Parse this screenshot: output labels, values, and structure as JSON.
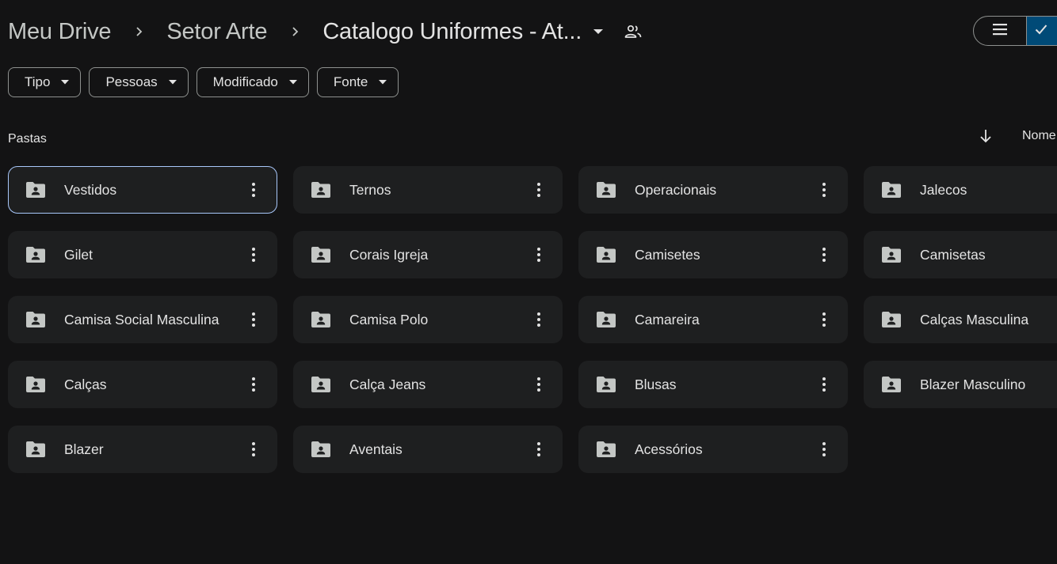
{
  "breadcrumb": {
    "items": [
      "Meu Drive",
      "Setor Arte"
    ],
    "current": "Catalogo Uniformes - At..."
  },
  "filters": [
    "Tipo",
    "Pessoas",
    "Modificado",
    "Fonte"
  ],
  "section": {
    "title": "Pastas",
    "sort_label": "Nome"
  },
  "folders": [
    "Vestidos",
    "Ternos",
    "Operacionais",
    "Jalecos",
    "Gilet",
    "Corais Igreja",
    "Camisetes",
    "Camisetas",
    "Camisa Social Masculina",
    "Camisa Polo",
    "Camareira",
    "Calças Masculina",
    "Calças",
    "Calça Jeans",
    "Blusas",
    "Blazer Masculino",
    "Blazer",
    "Aventais",
    "Acessórios"
  ],
  "selected_folder": "Vestidos",
  "icons": {
    "breadcrumb_separator": "chevron-right-icon",
    "title_dropdown": "caret-down-icon",
    "shared": "people-icon",
    "view_list": "list-view-icon",
    "view_grid_selected": "check-icon",
    "folder": "shared-folder-icon",
    "more": "more-vert-icon",
    "sort": "arrow-down-icon"
  },
  "colors": {
    "background": "#131314",
    "card": "#1e1f20",
    "selected_border": "#a8c7fa",
    "toggle_active": "#004a77"
  }
}
